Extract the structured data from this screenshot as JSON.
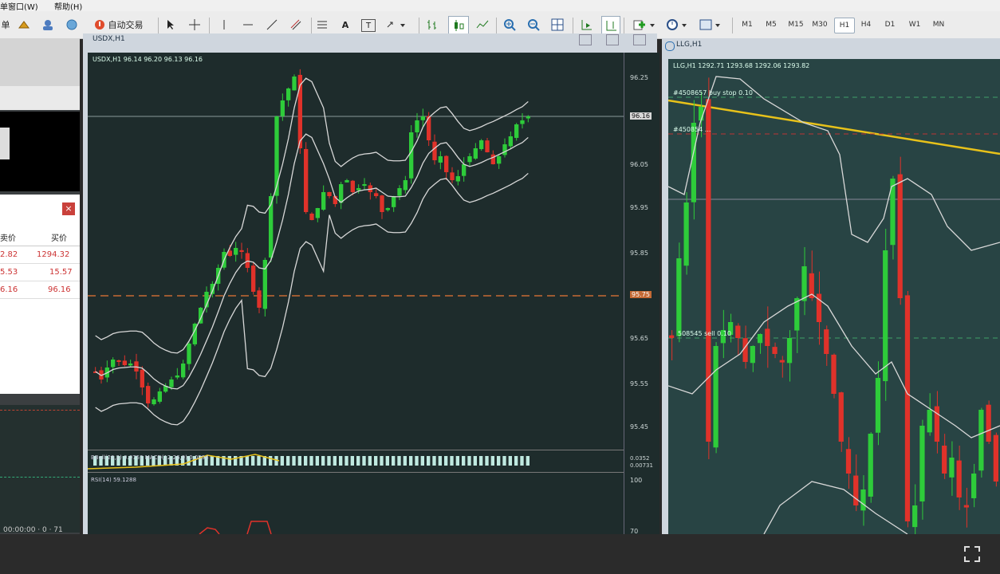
{
  "menu": {
    "window": "窗口(W)",
    "help": "帮助(H)",
    "left_cut": "单"
  },
  "toolbar": {
    "auto_trade": "自动交易",
    "text_tool": "A",
    "label_tool": "T",
    "timeframes": [
      "M1",
      "M5",
      "M15",
      "M30",
      "H1",
      "H4",
      "D1",
      "W1",
      "MN"
    ],
    "active_timeframe": "H1"
  },
  "market_watch": {
    "header_bid": "卖价",
    "header_ask": "买价",
    "rows": [
      {
        "bid": "2.82",
        "ask": "1294.32"
      },
      {
        "bid": "5.53",
        "ask": "15.57"
      },
      {
        "bid": "6.16",
        "ask": "96.16"
      }
    ],
    "close_symbol": "×",
    "status_text": "00:00:00 · 0 · 71"
  },
  "usdx_chart": {
    "window_title": "USDX,H1",
    "info": "USDX,H1  96.14 96.20 96.13 96.16",
    "current_price": "96.16",
    "level_price": "95.75",
    "price_scale": [
      "96.25",
      "96.15",
      "96.05",
      "95.95",
      "95.85",
      "95.65",
      "95.55",
      "95.45"
    ],
    "macd_text": "BBoll(20,2) 0.0752  MACD(12,26,9) 0.0294",
    "macd_scale": [
      "0.0352",
      "0.00731"
    ],
    "rsi_text": "RSI(14) 59.1288",
    "rsi_scale": [
      "100",
      "70"
    ]
  },
  "llg_chart": {
    "window_title": "LLG,H1",
    "info": "LLG,H1  1292.71 1293.68 1292.06 1293.82",
    "order_1": "#4508657 buy stop 0.10",
    "order_2": "#450854 ...",
    "order_3": "508545 sell 0.10"
  },
  "colors": {
    "bull": "#2ecc3a",
    "bear": "#e0322a",
    "bg": "#1e2c2c",
    "band": "#d8d8d8",
    "trendline": "#e8c21a"
  },
  "chart_data": {
    "type": "candlestick",
    "symbol": "USDX",
    "timeframe": "H1",
    "ylim": [
      95.4,
      96.3
    ]
  }
}
